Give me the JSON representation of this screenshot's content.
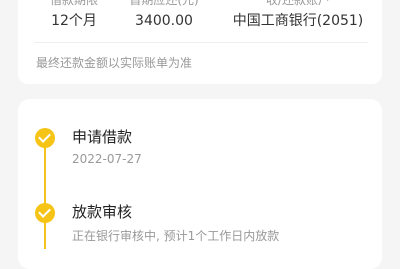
{
  "summary": {
    "columns": [
      {
        "label": "借款期限",
        "value": "12个月"
      },
      {
        "label": "首期应还(元)",
        "value": "3400.00"
      },
      {
        "label": "收/还款账户",
        "value": "中国工商银行(2051)"
      }
    ],
    "note": "最终还款金额以实际账单为准"
  },
  "timeline": {
    "steps": [
      {
        "title": "申请借款",
        "subtitle": "2022-07-27"
      },
      {
        "title": "放款审核",
        "subtitle": "正在银行审核中, 预计1个工作日内放款"
      }
    ]
  },
  "colors": {
    "accent": "#f6c417",
    "background": "#f5f5f5",
    "card": "#ffffff"
  }
}
